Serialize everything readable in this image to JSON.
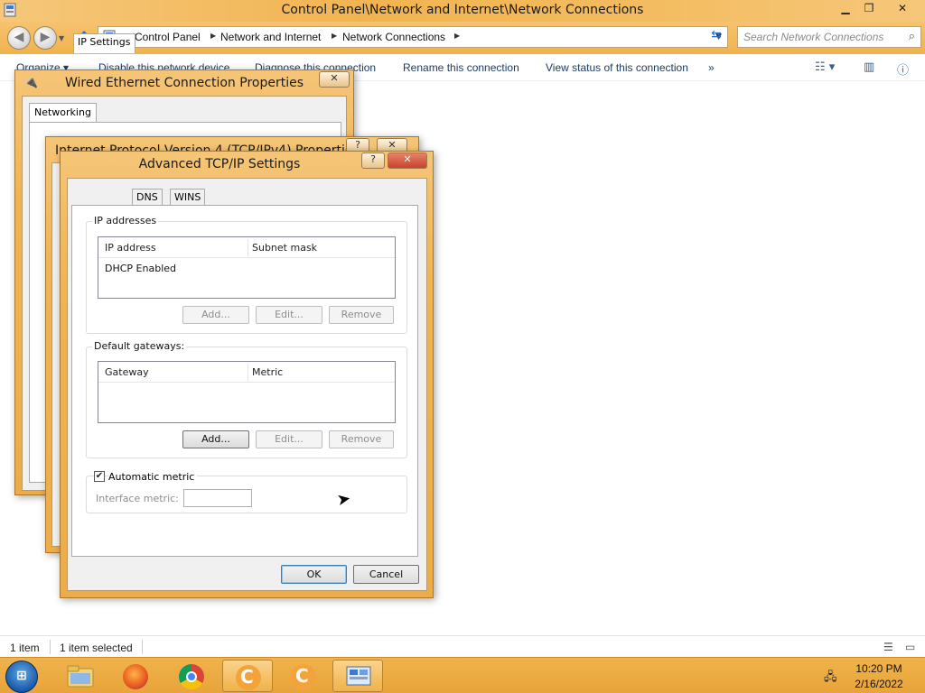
{
  "window": {
    "title": "Control Panel\\Network and Internet\\Network Connections",
    "min": "▁",
    "max": "❐",
    "close": "✕"
  },
  "address": {
    "crumbs": [
      "Control Panel",
      "Network and Internet",
      "Network Connections"
    ],
    "search_placeholder": "Search Network Connections"
  },
  "toolbar": {
    "items": [
      "Organize ▾",
      "Disable this network device",
      "Diagnose this connection",
      "Rename this connection",
      "View status of this connection",
      "»"
    ]
  },
  "status": {
    "count": "1 item",
    "selected": "1 item selected"
  },
  "taskbar": {
    "time": "10:20 PM",
    "date": "2/16/2022"
  },
  "dialog_wired": {
    "title": "Wired Ethernet Connection Properties",
    "tab": "Networking",
    "close": "✕"
  },
  "dialog_ipv4": {
    "title": "Internet Protocol Version 4 (TCP/IPv4) Properties",
    "help": "?",
    "close": "✕"
  },
  "dialog_adv": {
    "title": "Advanced TCP/IP Settings",
    "help": "?",
    "close": "✕",
    "tabs": [
      "IP Settings",
      "DNS",
      "WINS"
    ],
    "ip_group": {
      "legend": "IP addresses",
      "columns": [
        "IP address",
        "Subnet mask"
      ],
      "rows": [
        "DHCP Enabled"
      ],
      "buttons": [
        "Add...",
        "Edit...",
        "Remove"
      ]
    },
    "gw_group": {
      "legend": "Default gateways:",
      "columns": [
        "Gateway",
        "Metric"
      ],
      "buttons": [
        "Add...",
        "Edit...",
        "Remove"
      ]
    },
    "metric": {
      "checkbox_label": "Automatic metric",
      "checked": true,
      "field_label": "Interface metric:",
      "value": ""
    },
    "ok": "OK",
    "cancel": "Cancel"
  },
  "colors": {
    "titlebar": "#f1b451",
    "taskbar": "#e8a43a",
    "link_text": "#1e3c66"
  }
}
